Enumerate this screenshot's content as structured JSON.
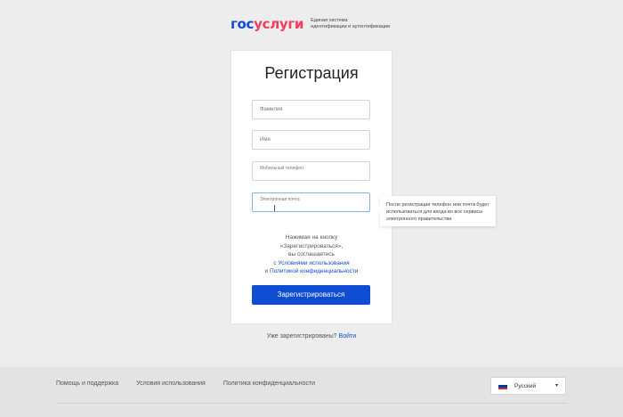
{
  "logo": {
    "gos": "гос",
    "uslugi": "услуги",
    "tagline_line1": "Единая система",
    "tagline_line2": "идентификации и аутентификации"
  },
  "form": {
    "title": "Регистрация",
    "fields": [
      {
        "placeholder": "Фамилия"
      },
      {
        "placeholder": "Имя"
      },
      {
        "placeholder": "Мобильный телефон"
      },
      {
        "placeholder": "Электронная почта"
      }
    ],
    "agreement": {
      "line1": "Нажимая на кнопку",
      "line2": "«Зарегистрироваться»,",
      "line3": "вы соглашаетесь",
      "prefix1": "с ",
      "terms_link": "Условиями использования",
      "prefix2": "и ",
      "privacy_link": "Политикой конфиденциальности"
    },
    "submit_label": "Зарегистрироваться"
  },
  "tooltip": {
    "text": "После регистрации телефон или почта будет использоваться для входа во все сервисы электронного правительства"
  },
  "already": {
    "text": "Уже зарегистрированы?",
    "link": "Войти"
  },
  "footer": {
    "links": [
      "Помощь и поддержка",
      "Условия использования",
      "Политика конфиденциальности"
    ],
    "language": "Русский",
    "flag_colors": [
      "#ffffff",
      "#0039a6",
      "#d52b1e"
    ]
  }
}
